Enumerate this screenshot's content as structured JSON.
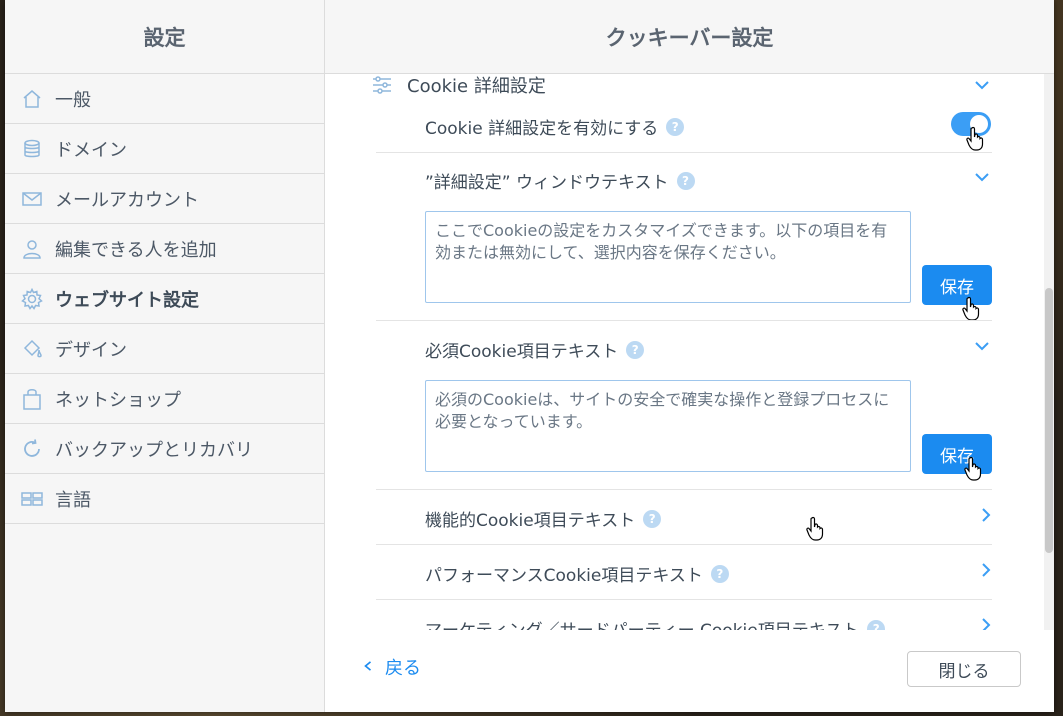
{
  "sidebar": {
    "title": "設定",
    "items": [
      {
        "label": "一般",
        "icon": "home-icon"
      },
      {
        "label": "ドメイン",
        "icon": "database-icon"
      },
      {
        "label": "メールアカウント",
        "icon": "mail-icon"
      },
      {
        "label": "編集できる人を追加",
        "icon": "user-icon"
      },
      {
        "label": "ウェブサイト設定",
        "icon": "gear-icon"
      },
      {
        "label": "デザイン",
        "icon": "paint-bucket-icon"
      },
      {
        "label": "ネットショップ",
        "icon": "shopping-bag-icon"
      },
      {
        "label": "バックアップとリカバリ",
        "icon": "refresh-icon"
      },
      {
        "label": "言語",
        "icon": "language-icon"
      }
    ]
  },
  "panel": {
    "title": "クッキーバー設定",
    "section_title": "Cookie 詳細設定",
    "enable_label": "Cookie 詳細設定を有効にする",
    "enable_on": true,
    "window_text_label": "”詳細設定” ウィンドウテキスト",
    "window_text_value": "ここでCookieの設定をカスタマイズできます。以下の項目を有効または無効にして、選択内容を保存ください。",
    "required_label": "必須Cookie項目テキスト",
    "required_value": "必須のCookieは、サイトの安全で確実な操作と登録プロセスに必要となっています。",
    "functional_label": "機能的Cookie項目テキスト",
    "performance_label": "パフォーマンスCookie項目テキスト",
    "marketing_label": "マーケティング／サードパーティー Cookie項目テキスト",
    "save_label": "保存",
    "help_glyph": "?",
    "accent_color": "#1b8bf0"
  },
  "footer": {
    "back_label": "戻る",
    "close_label": "閉じる"
  }
}
